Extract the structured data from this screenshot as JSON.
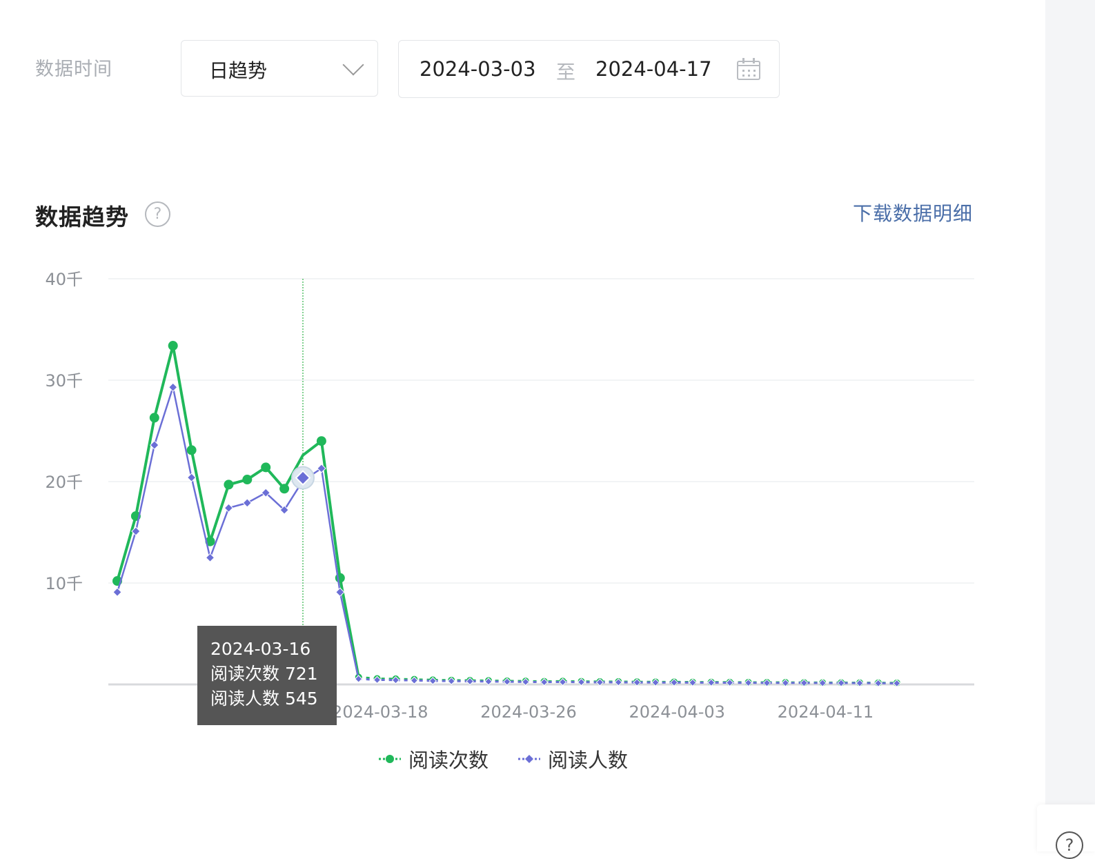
{
  "filter": {
    "label": "数据时间",
    "granularity": "日趋势",
    "date_start": "2024-03-03",
    "date_separator": "至",
    "date_end": "2024-04-17"
  },
  "section": {
    "title": "数据趋势",
    "help_icon": "question-circle-icon",
    "download_label": "下载数据明细"
  },
  "tooltip": {
    "date": "2024-03-16",
    "line1": "阅读次数 721",
    "line2": "阅读人数 545"
  },
  "colors": {
    "reads": "#20b85a",
    "readers": "#6b6fd6",
    "link": "#4a6ea8"
  },
  "chart_data": {
    "type": "line",
    "x": [
      "2024-03-06",
      "2024-03-07",
      "2024-03-08",
      "2024-03-09",
      "2024-03-10",
      "2024-03-11",
      "2024-03-12",
      "2024-03-13",
      "2024-03-14",
      "2024-03-15",
      "2024-03-16",
      "2024-03-17",
      "2024-03-18",
      "2024-03-19",
      "2024-03-20",
      "2024-03-21",
      "2024-03-22",
      "2024-03-23",
      "2024-03-24",
      "2024-03-25",
      "2024-03-26",
      "2024-03-27",
      "2024-03-28",
      "2024-03-29",
      "2024-03-30",
      "2024-03-31",
      "2024-04-01",
      "2024-04-02",
      "2024-04-03",
      "2024-04-04",
      "2024-04-05",
      "2024-04-06",
      "2024-04-07",
      "2024-04-08",
      "2024-04-09",
      "2024-04-10",
      "2024-04-11",
      "2024-04-12",
      "2024-04-13",
      "2024-04-14",
      "2024-04-15",
      "2024-04-16",
      "2024-04-17"
    ],
    "series": [
      {
        "name": "阅读次数",
        "marker": "circle",
        "values": [
          10200,
          16600,
          26300,
          33400,
          23100,
          14100,
          19700,
          20200,
          21400,
          19300,
          22600,
          24000,
          10500,
          721,
          580,
          550,
          500,
          450,
          420,
          400,
          380,
          350,
          330,
          300,
          320,
          300,
          280,
          280,
          260,
          250,
          250,
          230,
          230,
          220,
          210,
          200,
          200,
          190,
          180,
          180,
          170,
          160,
          150
        ]
      },
      {
        "name": "阅读人数",
        "marker": "diamond",
        "values": [
          9100,
          15100,
          23600,
          29300,
          20400,
          12500,
          17400,
          17900,
          18900,
          17200,
          20100,
          21300,
          9100,
          545,
          450,
          430,
          390,
          350,
          330,
          310,
          290,
          270,
          250,
          230,
          240,
          230,
          210,
          210,
          200,
          190,
          190,
          180,
          180,
          170,
          160,
          150,
          150,
          150,
          140,
          140,
          130,
          120,
          110
        ]
      }
    ],
    "x_ticks": [
      "2024-03-18",
      "2024-03-26",
      "2024-04-03",
      "2024-04-11"
    ],
    "y_ticks": [
      "10千",
      "20千",
      "30千",
      "40千"
    ],
    "y_tick_values": [
      10000,
      20000,
      30000,
      40000
    ],
    "ylim": [
      0,
      40000
    ],
    "grid": true,
    "highlighted_date": "2024-03-16",
    "legend_position": "bottom-center"
  }
}
